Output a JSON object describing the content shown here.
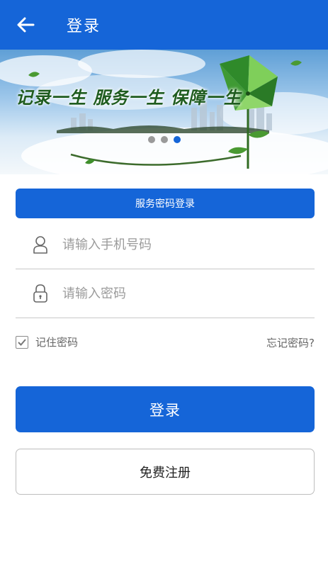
{
  "header": {
    "back_icon": "arrow-left-icon",
    "title": "登录"
  },
  "banner": {
    "slogan": "记录一生 服务一生 保障一生",
    "slide_count": 3,
    "active_slide": 3,
    "pinwheel_icon": "pinwheel-icon"
  },
  "service_login": {
    "label": "服务密码登录"
  },
  "phone": {
    "icon": "user-icon",
    "placeholder": "请输入手机号码",
    "value": ""
  },
  "password": {
    "icon": "lock-icon",
    "placeholder": "请输入密码",
    "value": ""
  },
  "remember": {
    "label": "记住密码",
    "checked": true
  },
  "forgot": {
    "label": "忘记密码?"
  },
  "login_button": {
    "label": "登录"
  },
  "register_button": {
    "label": "免费注册"
  },
  "colors": {
    "primary": "#1565d8",
    "divider": "#c8c8c8",
    "placeholder": "#9b9b9b"
  }
}
